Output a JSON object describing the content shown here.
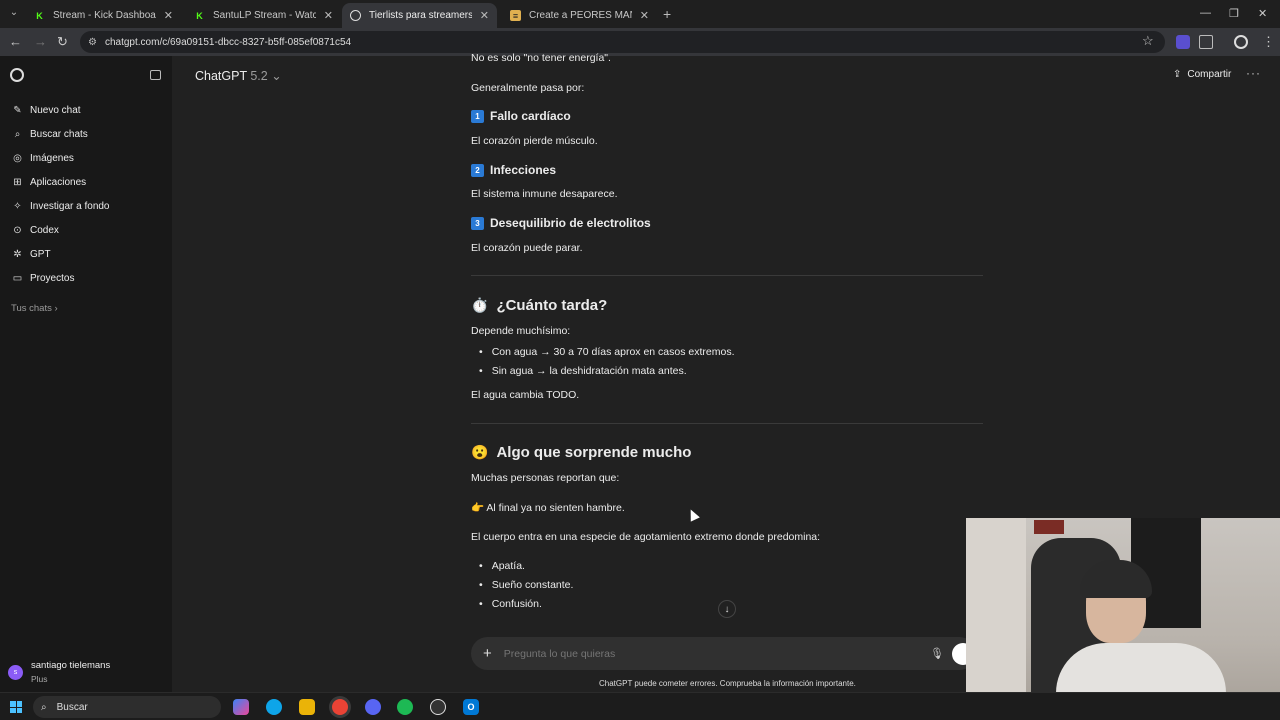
{
  "browser": {
    "tabs": [
      {
        "title": "Stream - Kick Dashboard",
        "favicon": "kick-icon",
        "color": "#53fc18",
        "active": false
      },
      {
        "title": "SantuLP Stream - Watch Live on",
        "favicon": "kick-icon",
        "color": "#53fc18",
        "active": false
      },
      {
        "title": "Tierlists para streamers",
        "favicon": "chatgpt-icon",
        "color": "#dddddd",
        "active": true
      },
      {
        "title": "Create a PEORES MANERAS DE",
        "favicon": "tiermaker-icon",
        "color": "#e0b050",
        "active": false
      }
    ],
    "url": "chatgpt.com/c/69a09151-dbcc-8327-b5ff-085ef0871c54"
  },
  "sidebar": {
    "items": [
      {
        "label": "Nuevo chat",
        "icon": "edit-icon"
      },
      {
        "label": "Buscar chats",
        "icon": "search-icon"
      },
      {
        "label": "Imágenes",
        "icon": "image-icon"
      },
      {
        "label": "Aplicaciones",
        "icon": "apps-icon"
      },
      {
        "label": "Investigar a fondo",
        "icon": "research-icon"
      },
      {
        "label": "Codex",
        "icon": "codex-icon"
      },
      {
        "label": "GPT",
        "icon": "gpt-icon"
      },
      {
        "label": "Proyectos",
        "icon": "folder-icon"
      }
    ],
    "section": "Tus chats",
    "user": {
      "name": "santiago tielemans",
      "plan": "Plus",
      "initial": "s"
    }
  },
  "header": {
    "title": "ChatGPT",
    "version": "5.2",
    "share": "Compartir"
  },
  "message": {
    "partial_top": "No es solo \"no tener energía\".",
    "intro": "Generalmente pasa por:",
    "causes": [
      {
        "num": "1",
        "title": "Fallo cardíaco",
        "desc": "El corazón pierde músculo."
      },
      {
        "num": "2",
        "title": "Infecciones",
        "desc": "El sistema inmune desaparece."
      },
      {
        "num": "3",
        "title": "Desequilibrio de electrolitos",
        "desc": "El corazón puede parar."
      }
    ],
    "section1": {
      "emoji": "⏱️",
      "title": "¿Cuánto tarda?",
      "intro": "Depende muchísimo:",
      "bullets": [
        "Con agua → 30 a 70 días aprox en casos extremos.",
        "Sin agua → la deshidratación mata antes."
      ],
      "outro": "El agua cambia TODO."
    },
    "section2": {
      "emoji": "😮",
      "title": "Algo que sorprende mucho",
      "intro": "Muchas personas reportan que:",
      "pointer_emoji": "👉",
      "pointer": "Al final ya no sienten hambre.",
      "body": "El cuerpo entra en una especie de agotamiento extremo donde predomina:",
      "bullets": [
        "Apatía.",
        "Sueño constante.",
        "Confusión."
      ]
    }
  },
  "composer": {
    "placeholder": "Pregunta lo que quieras"
  },
  "disclaimer": "ChatGPT puede cometer errores. Comprueba la información importante.",
  "taskbar": {
    "search": "Buscar"
  }
}
